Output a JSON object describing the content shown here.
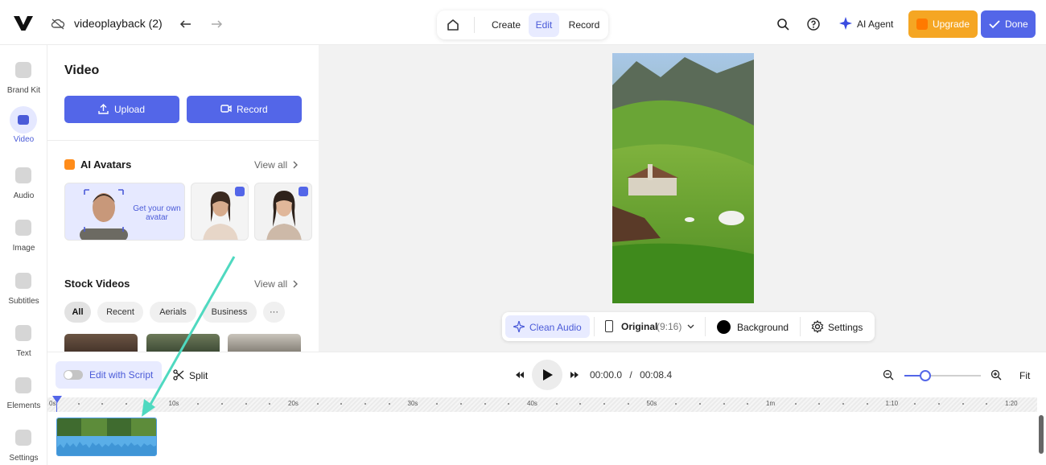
{
  "header": {
    "project_title": "videoplayback (2)",
    "modes": [
      "Create",
      "Edit",
      "Record"
    ],
    "active_mode": "Edit",
    "ai_agent_label": "AI Agent",
    "upgrade_label": "Upgrade",
    "done_label": "Done"
  },
  "rail": [
    {
      "label": "Brand Kit",
      "icon": "brand-kit-icon"
    },
    {
      "label": "Video",
      "icon": "video-icon",
      "active": true
    },
    {
      "label": "Audio",
      "icon": "audio-icon"
    },
    {
      "label": "Image",
      "icon": "image-icon"
    },
    {
      "label": "Subtitles",
      "icon": "subtitles-icon"
    },
    {
      "label": "Text",
      "icon": "text-icon"
    },
    {
      "label": "Elements",
      "icon": "elements-icon"
    },
    {
      "label": "Settings",
      "icon": "settings-icon"
    }
  ],
  "panel": {
    "title": "Video",
    "upload_label": "Upload",
    "record_label": "Record",
    "ai_avatars": {
      "title": "AI Avatars",
      "view_all": "View all",
      "own_avatar_text": "Get your own avatar"
    },
    "stock_videos": {
      "title": "Stock Videos",
      "view_all": "View all",
      "filters": [
        "All",
        "Recent",
        "Aerials",
        "Business"
      ],
      "active_filter": "All",
      "more_label": "···"
    }
  },
  "canvas_toolbar": {
    "clean_audio": "Clean Audio",
    "ratio_label": "Original",
    "ratio_value": "(9:16)",
    "background_label": "Background",
    "settings_label": "Settings"
  },
  "timeline": {
    "edit_with_script": "Edit with Script",
    "split_label": "Split",
    "current_time": "00:00.0",
    "separator": "/",
    "total_time": "00:08.4",
    "fit_label": "Fit",
    "zoom_level": 0.27,
    "ruler_labels": [
      "0s",
      "10s",
      "20s",
      "30s",
      "40s",
      "50s",
      "1m",
      "1:10",
      "1:20"
    ]
  },
  "colors": {
    "accent": "#5366e8",
    "upgrade": "#f5a623",
    "annotation_arrow": "#4fd9c0"
  }
}
